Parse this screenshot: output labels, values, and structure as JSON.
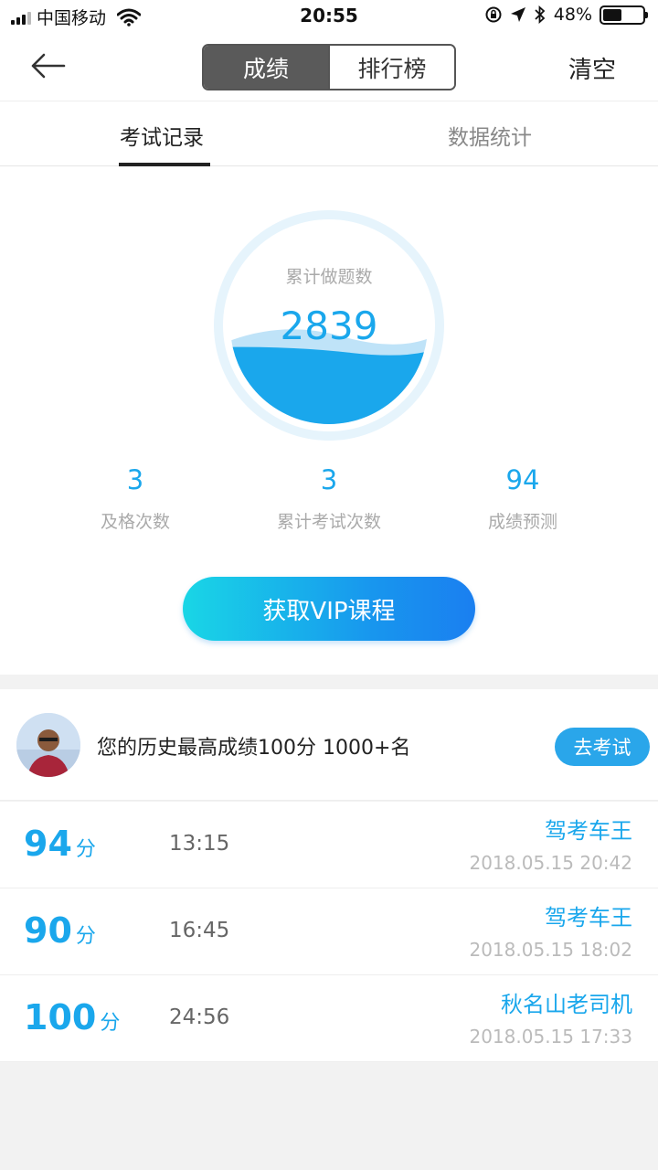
{
  "status_bar": {
    "carrier": "中国移动",
    "time": "20:55",
    "battery_percent": "48%",
    "battery_level": 0.48
  },
  "nav": {
    "segments": [
      "成绩",
      "排行榜"
    ],
    "active_segment": 0,
    "clear_label": "清空"
  },
  "tabs": {
    "items": [
      "考试记录",
      "数据统计"
    ],
    "active": 0
  },
  "summary": {
    "gauge_label": "累计做题数",
    "gauge_value": "2839",
    "metrics": [
      {
        "value": "3",
        "label": "及格次数"
      },
      {
        "value": "3",
        "label": "累计考试次数"
      },
      {
        "value": "94",
        "label": "成绩预测"
      }
    ],
    "vip_button": "获取VIP课程"
  },
  "best": {
    "text": "您的历史最高成绩100分  1000+名",
    "exam_button": "去考试"
  },
  "records": [
    {
      "score": "94",
      "unit": "分",
      "duration": "13:15",
      "name": "驾考车王",
      "date": "2018.05.15 20:42"
    },
    {
      "score": "90",
      "unit": "分",
      "duration": "16:45",
      "name": "驾考车王",
      "date": "2018.05.15 18:02"
    },
    {
      "score": "100",
      "unit": "分",
      "duration": "24:56",
      "name": "秋名山老司机",
      "date": "2018.05.15 17:33"
    }
  ],
  "colors": {
    "accent": "#1aa7ec",
    "segment_active": "#5a5a5a"
  }
}
